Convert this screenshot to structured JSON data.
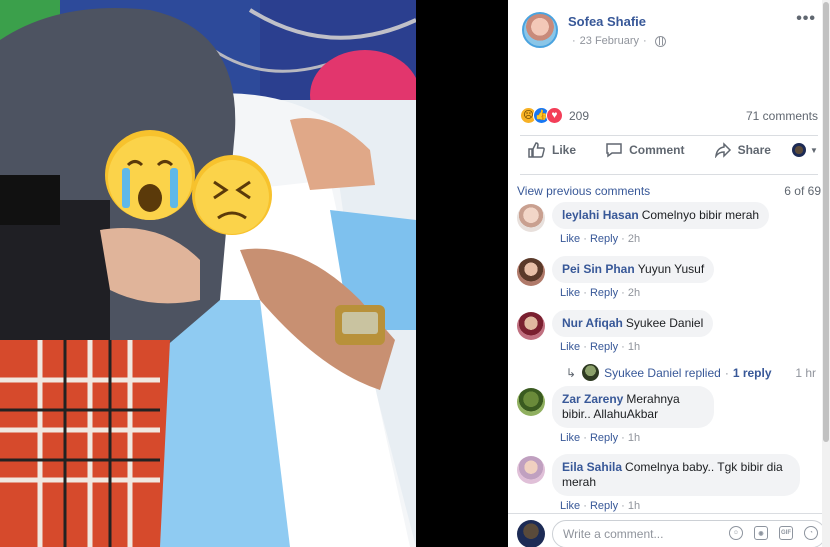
{
  "post": {
    "author": "Sofea Shafie",
    "date": "23 February",
    "date_separator": "·",
    "more_label": "•••"
  },
  "reactions": {
    "count": "209",
    "comments_count": "71 comments",
    "icons": [
      "sad-face-icon",
      "like-icon",
      "love-icon"
    ]
  },
  "actions": {
    "like": "Like",
    "comment": "Comment",
    "share": "Share"
  },
  "comments_section": {
    "view_previous": "View previous comments",
    "page_count": "6 of 69"
  },
  "comments": [
    {
      "author": "leylahi Hasan",
      "text": "Comelnyo bibir merah",
      "like": "Like",
      "reply": "Reply",
      "time": "2h"
    },
    {
      "author": "Pei Sin Phan",
      "text": "Yuyun Yusuf",
      "like": "Like",
      "reply": "Reply",
      "time": "2h"
    },
    {
      "author": "Nur Afiqah",
      "text": "Syukee Daniel",
      "like": "Like",
      "reply": "Reply",
      "time": "1h"
    },
    {
      "author": "Zar Zareny",
      "text": "Merahnya bibir.. AllahuAkbar",
      "like": "Like",
      "reply": "Reply",
      "time": "1h"
    },
    {
      "author": "Eila Sahila",
      "text": "Comelnya baby.. Tgk bibir dia merah",
      "like": "Like",
      "reply": "Reply",
      "time": "1h"
    }
  ],
  "reply_summary": {
    "text": "Syukee Daniel replied",
    "count": "1 reply",
    "time": "1 hr"
  },
  "composer": {
    "placeholder": "Write a comment...",
    "icons": [
      "emoji-icon",
      "camera-icon",
      "gif-icon",
      "sticker-icon"
    ],
    "gif_label": "GIF"
  },
  "colors": {
    "link": "#385898",
    "meta": "#90949c",
    "bubble": "#f2f3f5",
    "photo_background": "#000000"
  }
}
